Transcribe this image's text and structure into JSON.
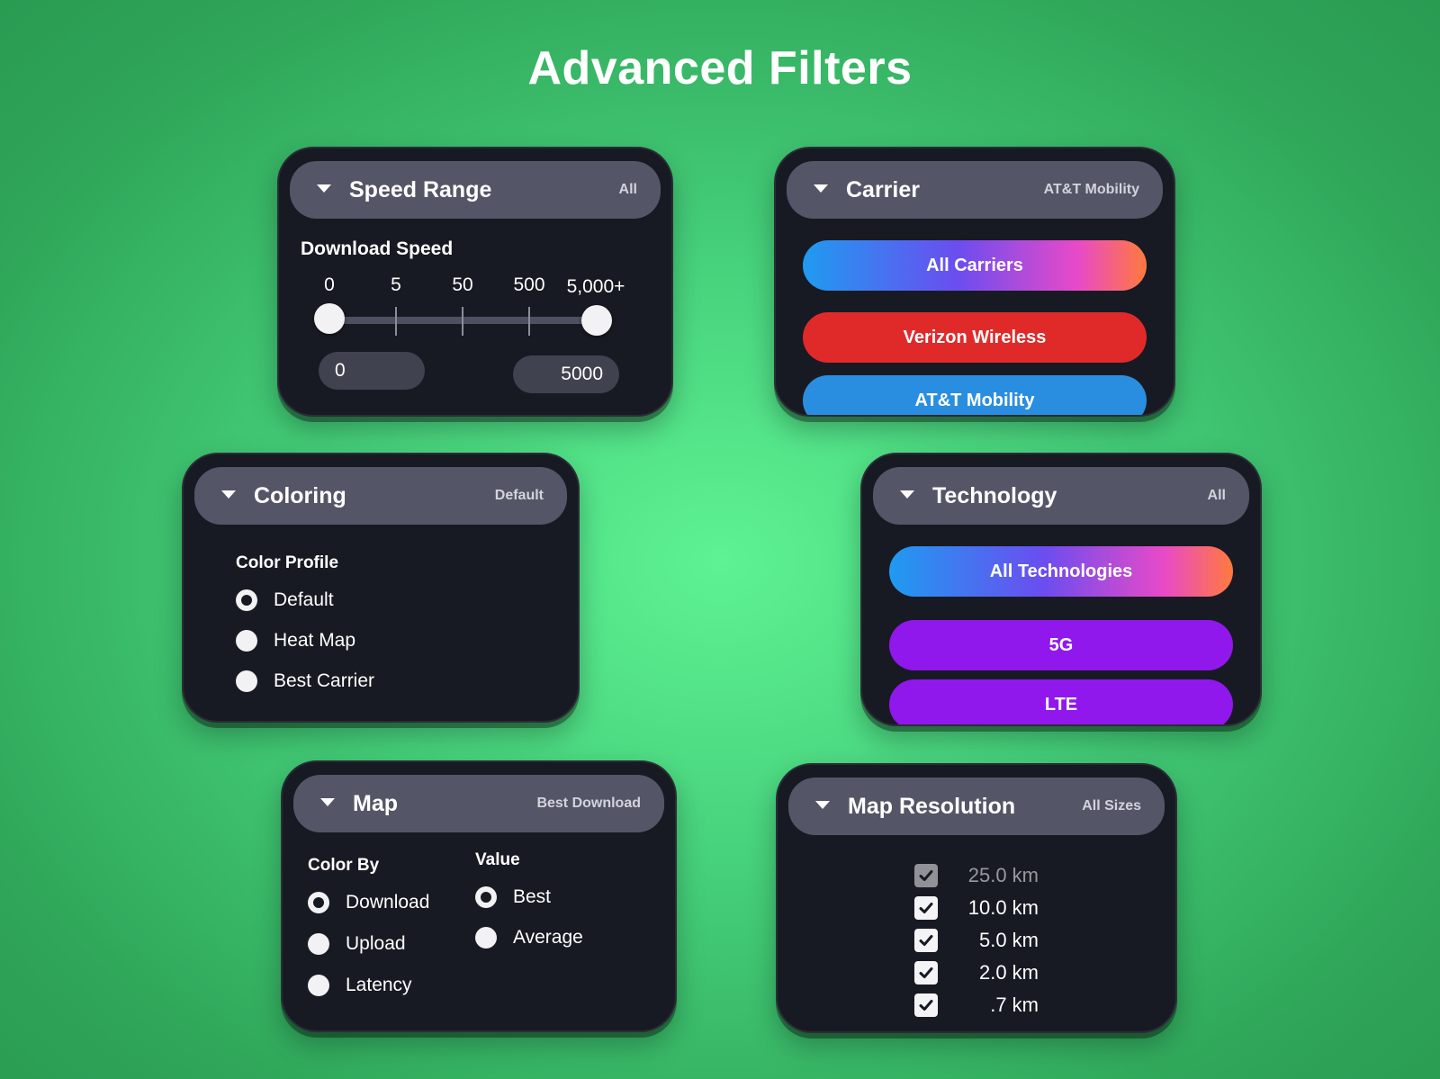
{
  "page": {
    "title": "Advanced Filters"
  },
  "speed_range": {
    "title": "Speed Range",
    "value": "All",
    "sub_label": "Download Speed",
    "ticks": [
      "0",
      "5",
      "50",
      "500",
      "5,000+"
    ],
    "min_field": "0",
    "max_field": "5000"
  },
  "carrier": {
    "title": "Carrier",
    "value": "AT&T Mobility",
    "options": [
      {
        "label": "All Carriers",
        "color": "gradient"
      },
      {
        "label": "Verizon Wireless",
        "color": "#e02a2a"
      },
      {
        "label": "AT&T Mobility",
        "color": "#2a8ee0"
      }
    ]
  },
  "coloring": {
    "title": "Coloring",
    "value": "Default",
    "sub_label": "Color Profile",
    "options": [
      {
        "label": "Default",
        "selected": true
      },
      {
        "label": "Heat Map",
        "selected": false
      },
      {
        "label": "Best Carrier",
        "selected": false
      }
    ]
  },
  "technology": {
    "title": "Technology",
    "value": "All",
    "options": [
      {
        "label": "All Technologies",
        "color": "gradient"
      },
      {
        "label": "5G",
        "color": "#9018ec"
      },
      {
        "label": "LTE",
        "color": "#9018ec"
      }
    ]
  },
  "map": {
    "title": "Map",
    "value": "Best Download",
    "color_by_label": "Color By",
    "color_by": [
      {
        "label": "Download",
        "selected": true
      },
      {
        "label": "Upload",
        "selected": false
      },
      {
        "label": "Latency",
        "selected": false
      }
    ],
    "value_label": "Value",
    "value_options": [
      {
        "label": "Best",
        "selected": true
      },
      {
        "label": "Average",
        "selected": false
      }
    ]
  },
  "map_resolution": {
    "title": "Map Resolution",
    "value": "All Sizes",
    "options": [
      {
        "label": "25.0 km",
        "checked": true
      },
      {
        "label": "10.0 km",
        "checked": true
      },
      {
        "label": "5.0 km",
        "checked": true
      },
      {
        "label": "2.0 km",
        "checked": true
      },
      {
        "label": ".7 km",
        "checked": true
      }
    ]
  },
  "colors": {
    "card_bg": "#181a23",
    "header_bg": "#545667",
    "gradient": "linear-gradient(90deg, #1f9bf0, #6b4df0 45%, #e84ac8 80%, #ff7a3c)"
  }
}
